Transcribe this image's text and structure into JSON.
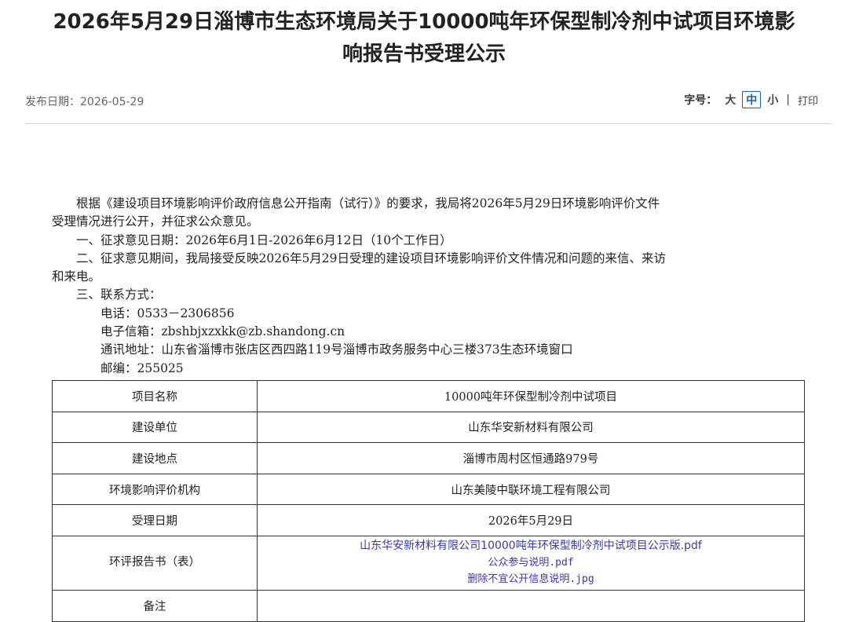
{
  "article": {
    "title_line1": "2026年5月29日淄博市生态环境局关于10000吨年环保型制冷剂中试项目环境影",
    "title_line2": "响报告书受理公示",
    "publish_date": "发布日期：2026-05-29",
    "font_label": "字号：",
    "font_large": "大",
    "font_medium": "中",
    "font_small": "小",
    "separator": "|",
    "print": "打印"
  },
  "content": {
    "p1_line1": "根据《建设项目环境影响评价政府信息公开指南（试行）》的要求，我局将2026年5月29日环境影响评价文件",
    "p1_line2": "受理情况进行公开，并征求公众意见。",
    "p2": "一、征求意见日期：2026年6月1日-2026年6月12日（10个工作日）",
    "p3_line1": "二、征求意见期间，我局接受反映2026年5月29日受理的建设项目环境影响评价文件情况和问题的来信、来访",
    "p3_line2": "和来电。",
    "p4": "三、联系方式：",
    "phone": "电话：0533－2306856",
    "email": "电子信箱：zbshbjxzxkk@zb.shandong.cn",
    "address": "通讯地址：山东省淄博市张店区西四路119号淄博市政务服务中心三楼373生态环境窗口",
    "postcode": "邮编：255025"
  },
  "table": {
    "rows": [
      {
        "label": "项目名称",
        "value": "10000吨年环保型制冷剂中试项目"
      },
      {
        "label": "建设单位",
        "value": "山东华安新材料有限公司"
      },
      {
        "label": "建设地点",
        "value": "淄博市周村区恒通路979号"
      },
      {
        "label": "环境影响评价机构",
        "value": "山东美陵中联环境工程有限公司"
      },
      {
        "label": "受理日期",
        "value": "2026年5月29日"
      }
    ],
    "report_label": "环评报告书（表）",
    "files": [
      "山东华安新材料有限公司10000吨年环保型制冷剂中试项目公示版.pdf",
      "公众参与说明.pdf",
      "删除不宜公开信息说明.jpg"
    ],
    "remark_label": "备注",
    "remark_value": ""
  },
  "colors": {
    "link": "#3a3aa8",
    "accent": "#1a5fb4",
    "text": "#222222"
  }
}
